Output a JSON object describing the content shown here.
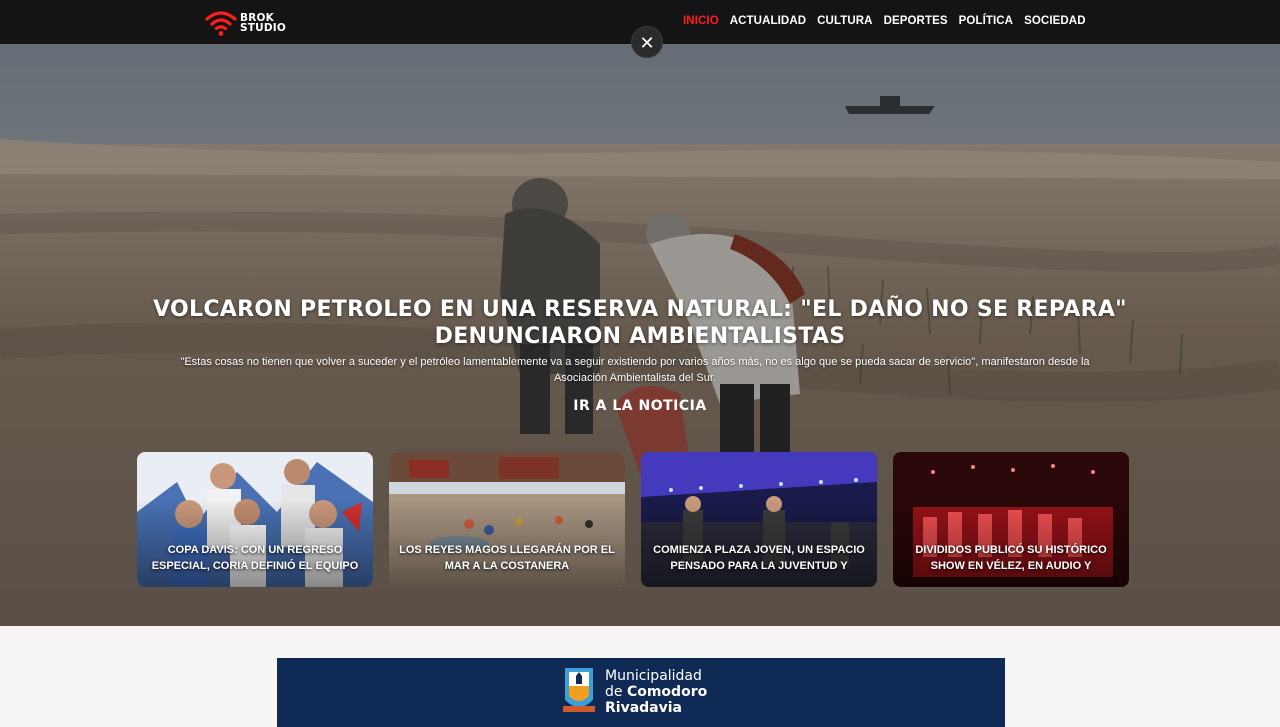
{
  "brand": {
    "line1": "BROK",
    "line2": "STUDIO",
    "icon": "wifi-signal-icon",
    "accent_color": "#ff1e1e"
  },
  "nav": {
    "items": [
      {
        "label": "INICIO",
        "active": true
      },
      {
        "label": "ACTUALIDAD",
        "active": false
      },
      {
        "label": "CULTURA",
        "active": false
      },
      {
        "label": "DEPORTES",
        "active": false
      },
      {
        "label": "POLÍTICA",
        "active": false
      },
      {
        "label": "SOCIEDAD",
        "active": false
      }
    ]
  },
  "close_button": {
    "label": "✕",
    "icon": "close-icon"
  },
  "hero": {
    "title": "VOLCARON PETROLEO EN UNA RESERVA NATURAL: \"EL DAÑO NO SE REPARA\" DENUNCIARON AMBIENTALISTAS",
    "summary": "\"Estas cosas no tienen que volver a suceder y el petróleo lamentablemente va a seguir existiendo por varios años más, no es algo que se pueda sacar de servicio\", manifestaron desde la Asociación Ambientalista del Sur.",
    "cta": "IR A LA NOTICIA"
  },
  "cards": [
    {
      "title": "COPA DAVIS: CON UN REGRESO ESPECIAL, CORIA DEFINIÓ EL EQUIPO"
    },
    {
      "title": "LOS REYES MAGOS LLEGARÁN POR EL MAR A LA COSTANERA"
    },
    {
      "title": "COMIENZA PLAZA JOVEN, UN ESPACIO PENSADO PARA LA JUVENTUD Y"
    },
    {
      "title": "DIVIDIDOS PUBLICÓ SU HISTÓRICO SHOW EN VÉLEZ, EN AUDIO Y"
    }
  ],
  "banner": {
    "line1": "Municipalidad",
    "line2_prefix": "de ",
    "line2_bold": "Comodoro",
    "line3": "Rivadavia",
    "background": "#0f2a55"
  }
}
